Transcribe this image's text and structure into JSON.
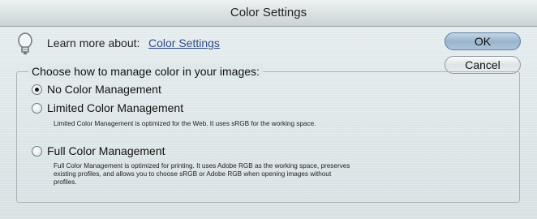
{
  "window": {
    "title": "Color Settings"
  },
  "learn": {
    "label": "Learn more about:",
    "link": "Color Settings"
  },
  "buttons": {
    "ok": "OK",
    "cancel": "Cancel"
  },
  "group": {
    "title": "Choose how to manage color in your images:",
    "options": [
      {
        "label": "No Color Management",
        "selected": true,
        "description": ""
      },
      {
        "label": "Limited Color Management",
        "selected": false,
        "description": "Limited Color Management is optimized for the Web. It uses sRGB for the working space."
      },
      {
        "label": "Full Color Management",
        "selected": false,
        "description_lines": [
          "Full Color Management is optimized for printing. It uses Adobe RGB as the working space, preserves",
          "existing profiles, and allows you to choose sRGB or Adobe RGB when opening images without",
          "profiles."
        ]
      }
    ]
  }
}
